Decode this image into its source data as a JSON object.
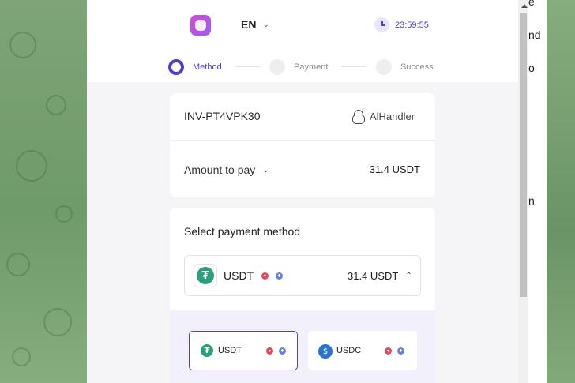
{
  "header": {
    "language": "EN",
    "timer": "23:59:55"
  },
  "stepper": {
    "steps": [
      {
        "label": "Method",
        "active": true
      },
      {
        "label": "Payment",
        "active": false
      },
      {
        "label": "Success",
        "active": false
      }
    ]
  },
  "invoice": {
    "id": "INV-PT4VPK30",
    "handler": "AlHandler"
  },
  "amount": {
    "label": "Amount to pay",
    "value": "31.4 USDT"
  },
  "payment": {
    "title": "Select payment method",
    "selected": {
      "token": "USDT",
      "amount": "31.4 USDT"
    },
    "options": [
      {
        "token": "USDT",
        "selected": true
      },
      {
        "token": "USDC",
        "selected": false
      }
    ]
  },
  "background": {
    "side_texts": [
      "e",
      "nd",
      "o",
      "n"
    ]
  },
  "colors": {
    "accent": "#4f3fd1",
    "tether": "#2aa07f",
    "usdc": "#2775ca",
    "tron": "#e8475b",
    "ethereum": "#6a7ee0"
  },
  "icons": [
    "app-logo-icon",
    "chevron-down-icon",
    "clock-icon",
    "lock-icon",
    "tether-icon",
    "usdc-icon",
    "tron-network-icon",
    "ethereum-network-icon",
    "chevron-up-icon"
  ]
}
